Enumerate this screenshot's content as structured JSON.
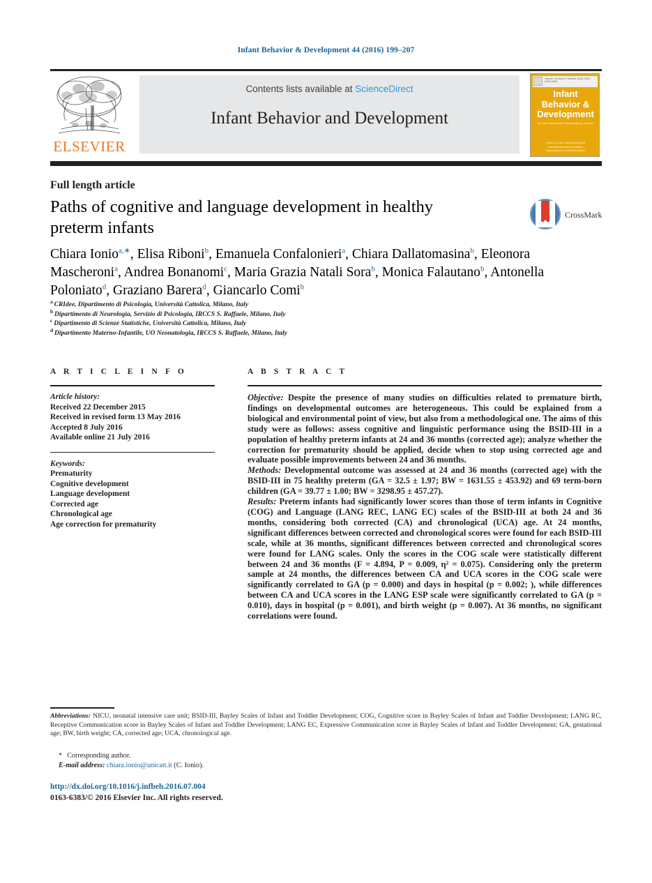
{
  "running_head": "Infant Behavior & Development 44 (2016) 199–207",
  "masthead": {
    "publisher_logo_label": "ELSEVIER",
    "contents_prefix": "Contents lists available at ",
    "contents_link": "ScienceDirect",
    "journal_title": "Infant Behavior and Development",
    "cover": {
      "topbar_text": "Volume 44  Issue 1  October 2016        ISSN 0163-6383",
      "title": "Infant Behavior & Development",
      "subtitle": "An International and Interdisciplinary Journal",
      "footer": "Editor-in-Chief: Martha Ann Bell\nInternational Advisory Board\nwww.elsevier.com/locate/infbeh"
    }
  },
  "article": {
    "type": "Full length article",
    "title": "Paths of cognitive and language development in healthy preterm infants",
    "crossmark_label": "CrossMark",
    "authors": [
      {
        "name": "Chiara Ionio",
        "sup": "a,",
        "star": true,
        "sep": ", "
      },
      {
        "name": "Elisa Riboni",
        "sup": "b",
        "star": false,
        "sep": ", "
      },
      {
        "name": "Emanuela Confalonieri",
        "sup": "a",
        "star": false,
        "sep": ", "
      },
      {
        "name": "Chiara Dallatomasina",
        "sup": "b",
        "star": false,
        "sep": ", "
      },
      {
        "name": "Eleonora Mascheroni",
        "sup": "a",
        "star": false,
        "sep": ", "
      },
      {
        "name": "Andrea Bonanomi",
        "sup": "c",
        "star": false,
        "sep": ", "
      },
      {
        "name": "Maria Grazia Natali Sora",
        "sup": "b",
        "star": false,
        "sep": ", "
      },
      {
        "name": "Monica Falautano",
        "sup": "b",
        "star": false,
        "sep": ", "
      },
      {
        "name": "Antonella Poloniato",
        "sup": "d",
        "star": false,
        "sep": ", "
      },
      {
        "name": "Graziano Barera",
        "sup": "d",
        "star": false,
        "sep": ", "
      },
      {
        "name": "Giancarlo Comi",
        "sup": "b",
        "star": false,
        "sep": ""
      }
    ],
    "affiliations": [
      {
        "marker": "a",
        "text": "CRIdee, Dipartimento di Psicologia, Università Cattolica, Milano, Italy"
      },
      {
        "marker": "b",
        "text": "Dipartimento di Neurologia, Servizio di Psicologia, IRCCS S. Raffaele, Milano, Italy"
      },
      {
        "marker": "c",
        "text": "Dipartimento di Scienze Statistiche, Università Cattolica, Milano, Italy"
      },
      {
        "marker": "d",
        "text": "Dipartimento Materno-Infantile, UO Neonatologia, IRCCS S. Raffaele, Milano, Italy"
      }
    ]
  },
  "article_info": {
    "heading": "A R T I C L E   I N F O",
    "history_label": "Article history:",
    "history": [
      "Received 22 December 2015",
      "Received in revised form 13 May 2016",
      "Accepted 8 July 2016",
      "Available online 21 July 2016"
    ],
    "keywords_label": "Keywords:",
    "keywords": [
      "Prematurity",
      "Cognitive development",
      "Language development",
      "Corrected age",
      "Chronological age",
      "Age correction for prematurity"
    ]
  },
  "abstract": {
    "heading": "A B S T R A C T",
    "objective_label": "Objective:",
    "objective_text": " Despite the presence of many studies on difficulties related to premature birth, findings on developmental outcomes are heterogeneous. This could be explained from a biological and environmental point of view, but also from a methodological one. The aims of this study were as follows: assess cognitive and linguistic performance using the BSID-III in a population of healthy preterm infants at 24 and 36 months (corrected age); analyze whether the correction for prematurity should be applied, decide when to stop using corrected age and evaluate possible improvements between 24 and 36 months.",
    "methods_label": "Methods:",
    "methods_text": " Developmental outcome was assessed at 24 and 36 months (corrected age) with the BSID-III in 75 healthy preterm (GA = 32.5 ± 1.97; BW = 1631.55 ± 453.92) and 69 term-born children (GA = 39.77 ± 1.00; BW = 3298.95 ± 457.27).",
    "results_label": "Results:",
    "results_text": " Preterm infants had significantly lower scores than those of term infants in Cognitive (COG) and Language (LANG REC, LANG EC) scales of the BSID-III at both 24 and 36 months, considering both corrected (CA) and chronological (UCA) age. At 24 months, significant differences between corrected and chronological scores were found for each BSID-III scale, while at 36 months, significant differences between corrected and chronological scores were found for LANG scales. Only the scores in the COG scale were statistically different between 24 and 36 months (F = 4.894, P = 0.009, η² = 0.075). Considering only the preterm sample at 24 months, the differences between CA and UCA scores in the COG scale were significantly correlated to GA (p = 0.000) and days in hospital (p = 0.002; ), while differences between CA and UCA scores in the LANG ESP scale were significantly correlated to GA (p = 0.010), days in hospital (p = 0.001), and birth weight (p = 0.007). At 36 months, no significant correlations were found."
  },
  "footnotes": {
    "abbrev_label": "Abbreviations:",
    "abbrev_text": "  NICU, neonatal intensive care unit; BSID-III, Bayley Scales of Infant and Toddler Development; COG, Cognitive score in Bayley Scales of Infant and Toddler Development; LANG RC, Receptive Communication score in Bayley Scales of Infant and Toddler Development; LANG EC, Expressive Communication score in Bayley Scales of Infant and Toddler Development; GA, gestational age; BW, birth weight; CA, corrected age; UCA, chronological age.",
    "corresponding_star": "*",
    "corresponding_text": "Corresponding author.",
    "email_label": "E-mail address:",
    "email": "chiara.ionio@unicatt.it",
    "email_owner": " (C. Ionio).",
    "doi": "http://dx.doi.org/10.1016/j.infbeh.2016.07.004",
    "copyright": "0163-6383/© 2016 Elsevier Inc. All rights reserved."
  },
  "colors": {
    "link_blue": "#1a6496",
    "sciencedirect_blue": "#2e9bd6",
    "elsevier_orange": "#e87722",
    "cover_yellow": "#e8a80c",
    "rule_black": "#231f20",
    "box_gray": "#e6e7e8"
  }
}
